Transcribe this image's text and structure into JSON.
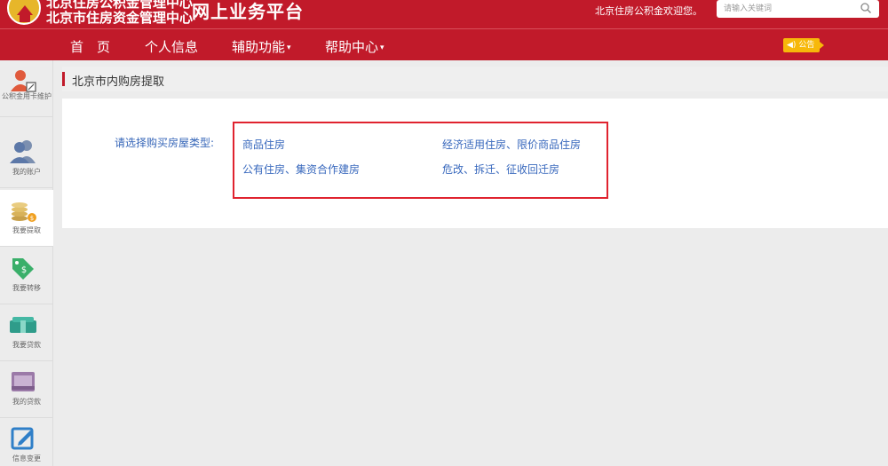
{
  "header": {
    "org_line1": "北京住房公积金管理中心",
    "org_line2": "北京市住房资金管理中心",
    "platform_title": "网上业务平台",
    "welcome": "北京住房公积金欢迎您。",
    "search_placeholder": "请输入关键词",
    "logo_icon": "beijing-housing-fund-logo",
    "search_icon": "search-icon",
    "brand_color": "#c11a2a"
  },
  "nav": {
    "items": [
      {
        "label": "首　页"
      },
      {
        "label": "个人信息"
      },
      {
        "label": "辅助功能",
        "caret": "▾"
      },
      {
        "label": "帮助中心",
        "caret": "▾"
      }
    ],
    "notice_label": "公告",
    "notice_icon": "speaker-icon",
    "notice_color": "#f7b80a"
  },
  "sidebar": {
    "items": [
      {
        "label": "公积金用卡维护",
        "icon": "user-card-edit-icon"
      },
      {
        "label": "我的账户",
        "icon": "users-icon"
      },
      {
        "label": "我要提取",
        "icon": "coins-withdraw-icon",
        "active": true
      },
      {
        "label": "我要转移",
        "icon": "money-tag-icon"
      },
      {
        "label": "我要贷款",
        "icon": "cash-stack-icon"
      },
      {
        "label": "我的贷款",
        "icon": "loan-box-icon"
      },
      {
        "label": "信息变更",
        "icon": "edit-icon"
      }
    ]
  },
  "breadcrumb": {
    "title": "北京市内购房提取"
  },
  "form": {
    "label": "请选择购买房屋类型:",
    "options": [
      "商品住房",
      "经济适用住房、限价商品住房",
      "公有住房、集资合作建房",
      "危改、拆迁、征收回迁房"
    ],
    "link_color": "#3868bd",
    "highlight_color": "#e0232f"
  }
}
